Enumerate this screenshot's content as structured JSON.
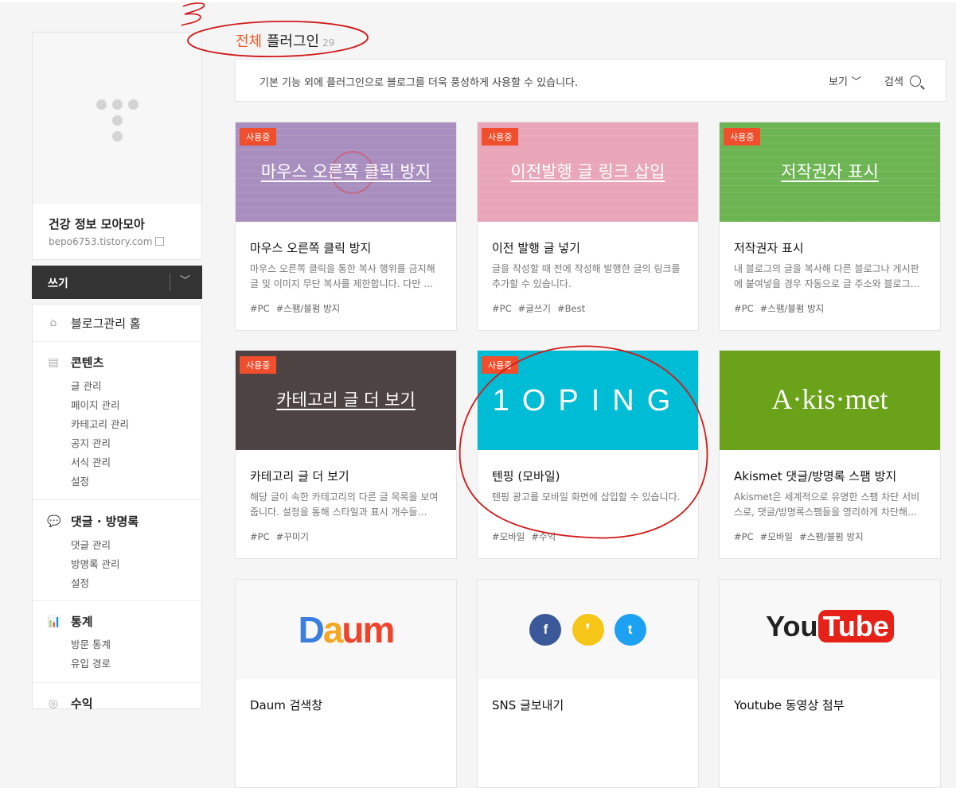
{
  "blog": {
    "name": "건강 정보 모아모아",
    "url": "bepo6753.tistory.com"
  },
  "write_button": {
    "label": "쓰기"
  },
  "menu": {
    "home": "블로그관리 홈",
    "contents": {
      "title": "콘텐츠",
      "items": [
        "글 관리",
        "페이지 관리",
        "카테고리 관리",
        "공지 관리",
        "서식 관리",
        "설정"
      ]
    },
    "comments": {
      "title": "댓글 · 방명록",
      "items": [
        "댓글 관리",
        "방명록 관리",
        "설정"
      ]
    },
    "stats": {
      "title": "통계",
      "items": [
        "방문 통계",
        "유입 경로"
      ]
    },
    "revenue": {
      "title": "수익"
    }
  },
  "header": {
    "title_accent": "전체",
    "title_rest": "플러그인",
    "count": "29",
    "description": "기본 기능 외에 플러그인으로 블로그를 더욱 풍성하게 사용할 수 있습니다.",
    "view_label": "보기",
    "search_label": "검색"
  },
  "badge_label": "사용중",
  "plugins": [
    {
      "thumb_title": "마우스 오른쪽 클릭 방지",
      "name": "마우스 오른쪽 클릭 방지",
      "desc": "마우스 오른쪽 클릭을 통한 복사 행위를 금지해 글 및 이미지 무단 복사를 제한합니다. 다만 …",
      "tags": [
        "#PC",
        "#스팸/블펌 방지"
      ],
      "color": "#a98fc0"
    },
    {
      "thumb_title": "이전발행 글 링크 삽입",
      "name": "이전 발행 글 넣기",
      "desc": "글을 작성할 때 전에 작성해 발행한 글의 링크를 추가할 수 있습니다.",
      "tags": [
        "#PC",
        "#글쓰기",
        "#Best"
      ],
      "color": "#e8a6b8"
    },
    {
      "thumb_title": "저작권자 표시",
      "name": "저작권자 표시",
      "desc": "내 블로그의 글을 복사해 다른 블로그나 게시판에 붙여넣을 경우 자동으로 글 주소와 블로그…",
      "tags": [
        "#PC",
        "#스팸/블펌 방지"
      ],
      "color": "#6cb552"
    },
    {
      "thumb_title": "카테고리 글 더 보기",
      "name": "카테고리 글 더 보기",
      "desc": "해당 글이 속한 카테고리의 다른 글 목록을 보여줍니다. 설정을 통해 스타일과 표시 개수들…",
      "tags": [
        "#PC",
        "#꾸미기"
      ],
      "color": "#4e4343"
    },
    {
      "logo": "1OPING",
      "name": "텐핑 (모바일)",
      "desc": "텐핑 광고를 모바일 화면에 삽입할 수 있습니다.",
      "tags": [
        "#모바일",
        "#수익"
      ],
      "color": "#00bcd4"
    },
    {
      "logo": "A·kis·met",
      "name": "Akismet 댓글/방명록 스팸 방지",
      "desc": "Akismet은 세계적으로 유명한 스팸 차단 서비스로, 댓글/방명록스팸들을 영리하게 차단해…",
      "tags": [
        "#PC",
        "#모바일",
        "#스팸/블펌 방지"
      ],
      "color": "#6aa31a"
    },
    {
      "logo": "Daum",
      "name": "Daum 검색창",
      "color": "#f8f8f8"
    },
    {
      "logo_f": "f",
      "logo_k": "❜",
      "logo_t": "t",
      "name": "SNS 글보내기",
      "color": "#f8f8f8"
    },
    {
      "logo_you": "You",
      "logo_tube": "Tube",
      "name": "Youtube 동영상 첨부",
      "color": "#f8f8f8"
    }
  ],
  "colors": {
    "accent": "#f05a28",
    "badge": "#f04e2c",
    "annotation": "#d11a1a"
  }
}
